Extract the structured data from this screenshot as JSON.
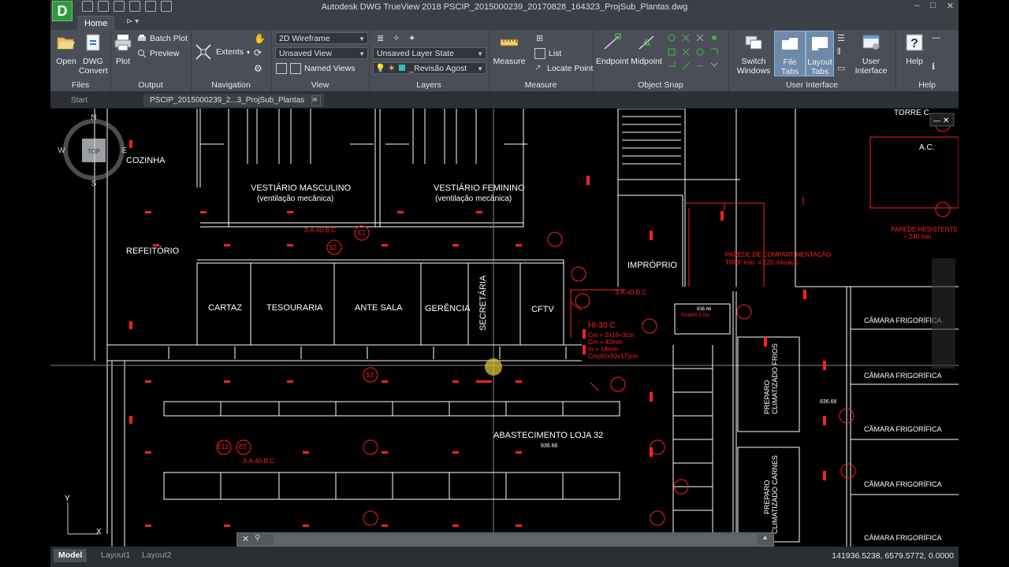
{
  "app": {
    "icon_letter": "D",
    "title": "Autodesk DWG TrueView 2018   PSCIP_2015000239_20170828_164323_ProjSub_Plantas.dwg",
    "window_controls": [
      "–",
      "□",
      "✕"
    ]
  },
  "ribbon_tabs": {
    "home": "Home",
    "extra": "⊳ ▾"
  },
  "ribbon": {
    "files": {
      "title": "Files",
      "open": "Open",
      "convert": "DWG Convert"
    },
    "output": {
      "title": "Output",
      "plot": "Plot",
      "batch_plot": "Batch Plot",
      "preview": "Preview"
    },
    "navigation": {
      "title": "Navigation",
      "extents": "Extents"
    },
    "view": {
      "title": "View",
      "visual_style": "2D Wireframe",
      "unsaved_view": "Unsaved View",
      "named_views": "Named Views"
    },
    "layers": {
      "title": "Layers",
      "layer_state": "Unsaved Layer State",
      "current_layer": "_Revisão Agost"
    },
    "measure": {
      "title": "Measure",
      "measure": "Measure",
      "list": "List",
      "locate_point": "Locate Point"
    },
    "object_snap": {
      "title": "Object Snap",
      "endpoint": "Endpoint",
      "midpoint": "Midpoint"
    },
    "user_interface": {
      "title": "User Interface",
      "switch_windows": "Switch Windows",
      "file_tabs": "File Tabs",
      "layout_tabs": "Layout Tabs",
      "user_interface": "User Interface"
    },
    "help": {
      "title": "Help",
      "help": "Help"
    }
  },
  "doc_tabs": {
    "start": "Start",
    "current": "PSCIP_2015000239_2...3_ProjSub_Plantas",
    "close": "✕",
    "new": "+"
  },
  "drawing": {
    "rooms": {
      "cozinha": "COZINHA",
      "vest_masc": "VESTIÁRIO MASCULINO",
      "vest_masc_sub": "(ventilação mecânica)",
      "vest_fem": "VESTIÁRIO FEMININO",
      "vest_fem_sub": "(ventilação mecânica)",
      "refeitorio": "REFEITÓRIO",
      "cartaz": "CARTAZ",
      "tesouraria": "TESOURARIA",
      "ante_sala": "ANTE SALA",
      "gerencia": "GERÊNCIA",
      "secretaria": "SECRETÁRIA",
      "cftv": "CFTV",
      "improprio": "IMPRÓPRIO",
      "abastecimento": "ABASTECIMENTO LOJA 32",
      "preparo_frios": "PREPARO",
      "preparo_frios_sub": "CLIMATIZADO FRIOS",
      "preparo_carnes": "PREPARO",
      "preparo_carnes_sub": "CLIMATIZADO CARNES",
      "camara1": "CÂMARA FRIGORÍFICA",
      "camara2": "CÂMARA FRIGORÍFICA",
      "camara3": "CÂMARA FRIGORÍFICA",
      "camara4": "CÂMARA FRIGORÍFICA",
      "camara5": "CÂMARA FRIGORÍFICA",
      "torre": "TORRE C",
      "ac": "A.C."
    },
    "red_notes": {
      "parede": "PAREDE DE COMPARTIMENTAÇÃO",
      "trrf": "TRRF mín. = 120 minutos",
      "hi30": "HI-30 C",
      "dims1": "Cm = 2x16=3cm",
      "dims2": "Cm = 40mm",
      "dims3": "m = 18mm",
      "dims4": "Cm(60x90x17)cm",
      "a40a": "3-A-40-B:C",
      "a40b": "3-A-40-B:C",
      "a40c": "3-A-40-B:C",
      "rampa": "RAMPA 8.5%",
      "parede_res": "PAREDE RESISTENTE",
      "parede_res2": "> 240 min",
      "s2": "S2",
      "s3": "S3",
      "e1": "E1",
      "e5": "E5",
      "e12": "E12"
    },
    "elevations": [
      "836.66",
      "836.66",
      "836.66"
    ],
    "navcube": {
      "top": "TOP",
      "n": "N",
      "s": "S",
      "e": "E",
      "w": "W"
    },
    "ucs": {
      "x": "X",
      "y": "Y"
    }
  },
  "status": {
    "model": "Model",
    "layout1": "Layout1",
    "layout2": "Layout2",
    "coordinates": "141936.5238, 6579.5772, 0.0000"
  },
  "cmdline": {
    "close": "✕",
    "icon": "⚲",
    "arrow": "▲"
  }
}
